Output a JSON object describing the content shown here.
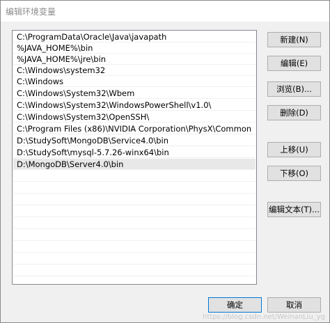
{
  "window": {
    "title": "编辑环境变量"
  },
  "path_list": {
    "items": [
      "C:\\ProgramData\\Oracle\\Java\\javapath",
      "%JAVA_HOME%\\bin",
      "%JAVA_HOME%\\jre\\bin",
      "C:\\Windows\\system32",
      "C:\\Windows",
      "C:\\Windows\\System32\\Wbem",
      "C:\\Windows\\System32\\WindowsPowerShell\\v1.0\\",
      "C:\\Windows\\System32\\OpenSSH\\",
      "C:\\Program Files (x86)\\NVIDIA Corporation\\PhysX\\Common",
      "D:\\StudySoft\\MongoDB\\Service4.0\\bin",
      "D:\\StudySoft\\mysql-5.7.26-winx64\\bin",
      "D:\\MongoDB\\Server4.0\\bin"
    ],
    "selected_index": 11
  },
  "buttons": {
    "new": "新建(N)",
    "edit": "编辑(E)",
    "browse": "浏览(B)...",
    "delete": "删除(D)",
    "move_up": "上移(U)",
    "move_down": "下移(O)",
    "edit_text": "编辑文本(T)..."
  },
  "footer": {
    "ok": "确定",
    "cancel": "取消"
  },
  "watermark": "https://blog.csdn.net/WeinanLiu_yg"
}
